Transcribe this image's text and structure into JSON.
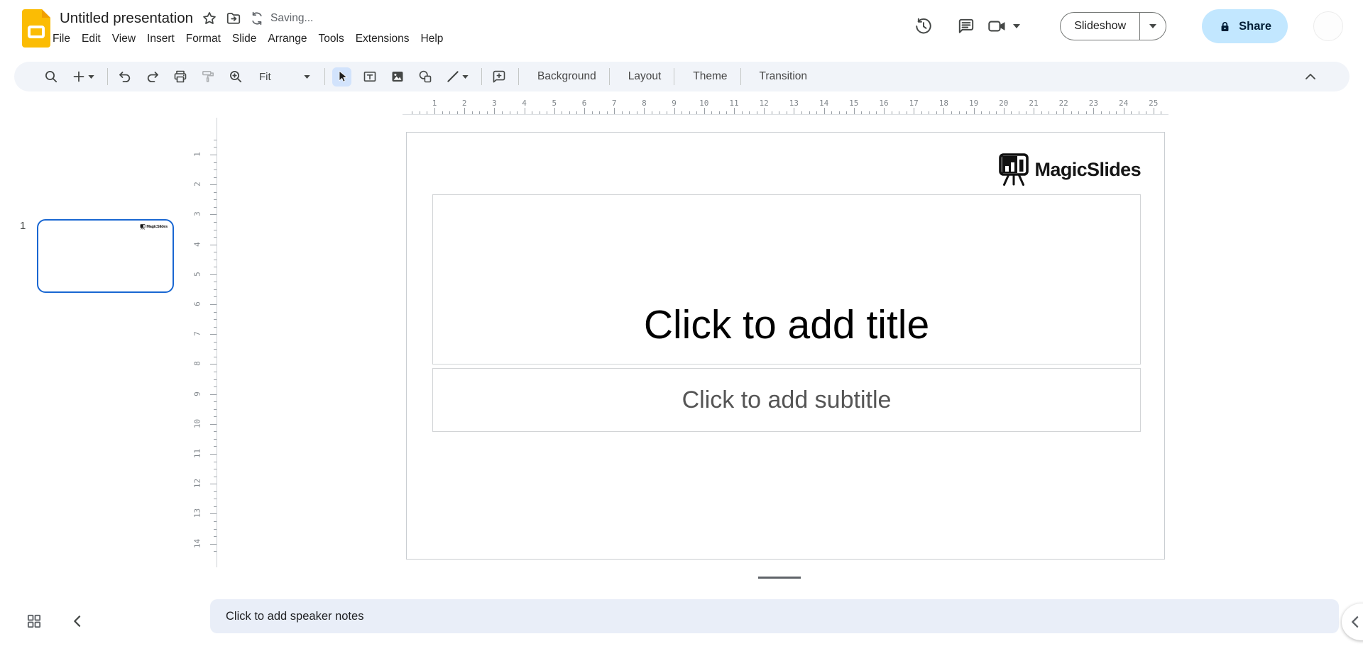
{
  "header": {
    "doc_title": "Untitled presentation",
    "saving_status": "Saving...",
    "menus": [
      "File",
      "Edit",
      "View",
      "Insert",
      "Format",
      "Slide",
      "Arrange",
      "Tools",
      "Extensions",
      "Help"
    ],
    "slideshow_label": "Slideshow",
    "share_label": "Share"
  },
  "toolbar": {
    "zoom_fit_label": "Fit",
    "background_label": "Background",
    "layout_label": "Layout",
    "theme_label": "Theme",
    "transition_label": "Transition"
  },
  "filmstrip": {
    "slide_number": "1"
  },
  "rulers": {
    "horizontal": [
      "1",
      "2",
      "3",
      "4",
      "5",
      "6",
      "7",
      "8",
      "9",
      "10",
      "11",
      "12",
      "13",
      "14",
      "15",
      "16",
      "17",
      "18",
      "19",
      "20",
      "21",
      "22",
      "23",
      "24",
      "25"
    ],
    "vertical": [
      "1",
      "2",
      "3",
      "4",
      "5",
      "6",
      "7",
      "8",
      "9",
      "10",
      "11",
      "12",
      "13",
      "14"
    ]
  },
  "canvas": {
    "brand_logo_text": "MagicSlides",
    "title_placeholder": "Click to add title",
    "subtitle_placeholder": "Click to add subtitle"
  },
  "notes": {
    "placeholder": "Click to add speaker notes"
  },
  "colors": {
    "slides_logo_yellow": "#fbbc04",
    "selected_tool_bg": "#d2e3fc",
    "thumbnail_selected_border": "#1967d2",
    "share_button_bg": "#c2e7ff",
    "share_button_text": "#001d35",
    "toolbar_bg": "#f1f4f9",
    "notes_bg": "#e9eef8",
    "ruler_text": "#80868b",
    "icon_gray": "#444746"
  }
}
